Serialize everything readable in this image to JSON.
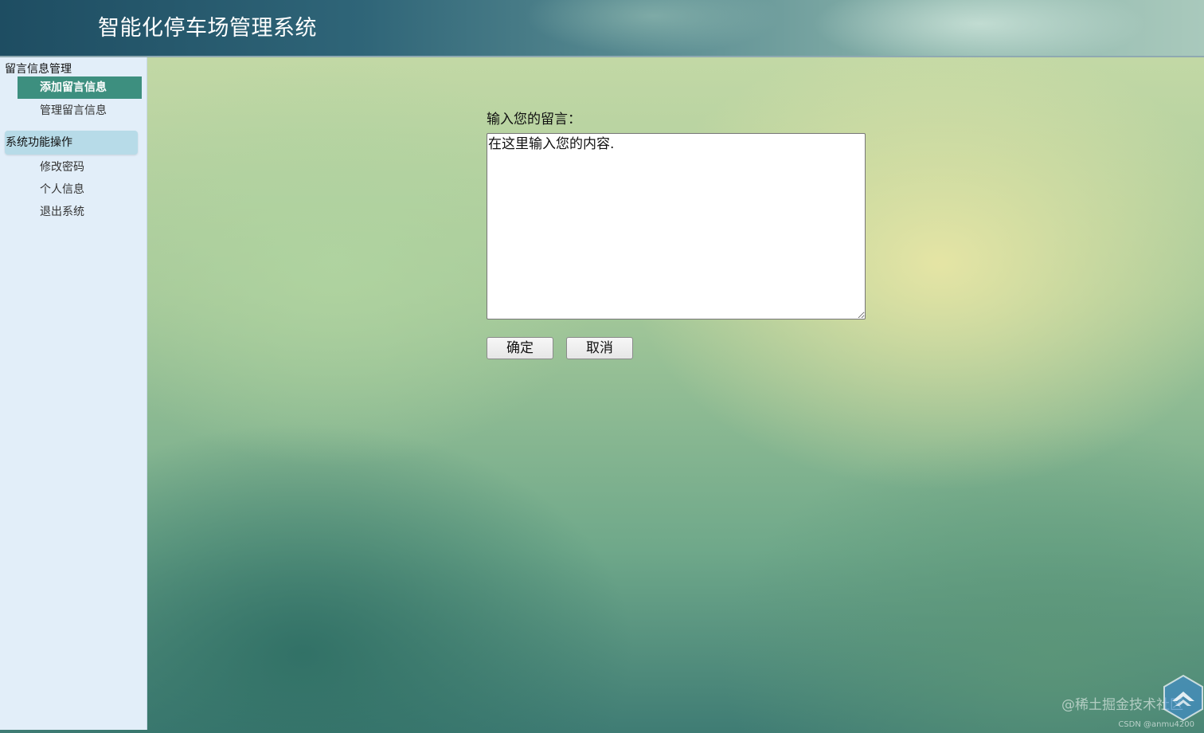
{
  "header": {
    "title": "智能化停车场管理系统"
  },
  "sidebar": {
    "sections": [
      {
        "label": "留言信息管理",
        "items": [
          {
            "label": "添加留言信息",
            "active": true
          },
          {
            "label": "管理留言信息",
            "active": false
          }
        ]
      },
      {
        "label": "系统功能操作",
        "items": [
          {
            "label": "修改密码",
            "active": false
          },
          {
            "label": "个人信息",
            "active": false
          },
          {
            "label": "退出系统",
            "active": false
          }
        ]
      }
    ]
  },
  "form": {
    "label": "输入您的留言：",
    "textarea_value": "在这里输入您的内容.",
    "confirm_label": "确定",
    "cancel_label": "取消"
  },
  "watermark": {
    "text": "@稀土掘金技术社区",
    "sub": "CSDN @anmu4200",
    "logo_icon": "juejin-logo-icon"
  },
  "colors": {
    "active_menu": "#3d8f7f",
    "section_highlight": "#b7dbe8",
    "sidebar_bg": "#e2eef9"
  }
}
